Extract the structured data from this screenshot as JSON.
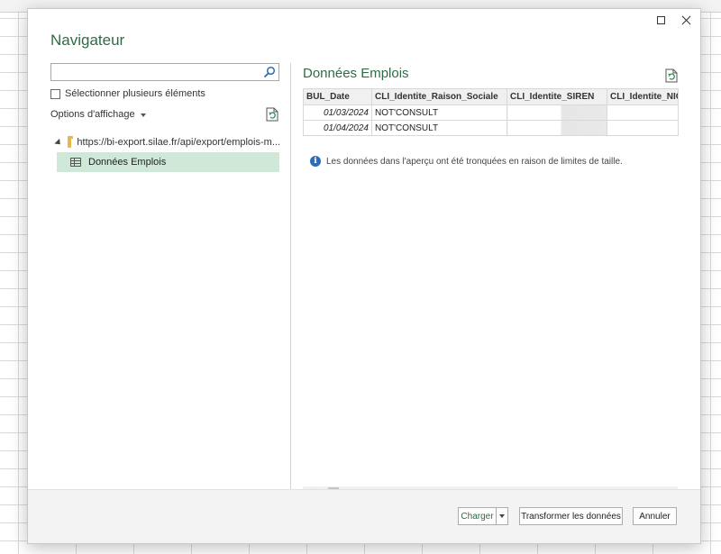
{
  "dialog": {
    "title": "Navigateur"
  },
  "left_pane": {
    "search": {
      "value": "",
      "placeholder": ""
    },
    "multi_select_label": "Sélectionner plusieurs éléments",
    "display_options_label": "Options d'affichage",
    "tree": {
      "root_label": "https://bi-export.silae.fr/api/export/emplois-m...",
      "child_label": "Données Emplois"
    }
  },
  "preview": {
    "title": "Données Emplois",
    "columns": [
      "BUL_Date",
      "CLI_Identite_Raison_Sociale",
      "CLI_Identite_SIREN",
      "CLI_Identite_NIC"
    ],
    "rows": [
      [
        "01/03/2024",
        "NOT'CONSULT",
        "",
        ""
      ],
      [
        "01/04/2024",
        "NOT'CONSULT",
        "",
        ""
      ]
    ],
    "info_text": "Les données dans l'aperçu ont été tronquées en raison de limites de taille."
  },
  "footer": {
    "load_label": "Charger",
    "transform_label": "Transformer les données",
    "cancel_label": "Annuler"
  },
  "colors": {
    "accent_green": "#2f6b46",
    "selection_bg": "#cfe8d8",
    "info_blue": "#2a6cb8"
  }
}
